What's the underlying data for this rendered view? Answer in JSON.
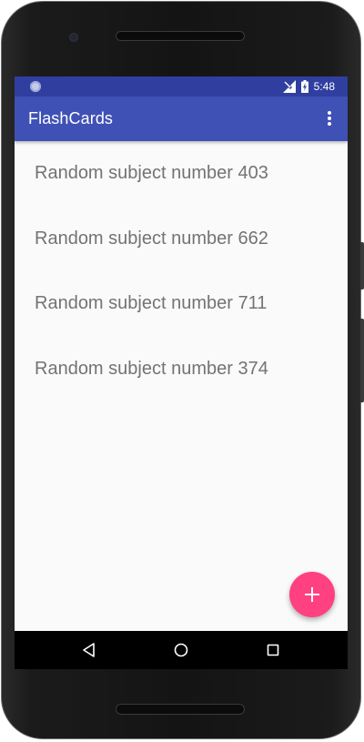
{
  "status_bar": {
    "time": "5:48",
    "icons": [
      "notification-dot-icon",
      "no-signal-icon",
      "battery-charging-icon"
    ]
  },
  "app_bar": {
    "title": "FlashCards",
    "menu_icon": "more-vert-icon"
  },
  "subjects": [
    {
      "label": "Random subject number 403"
    },
    {
      "label": "Random subject number 662"
    },
    {
      "label": "Random subject number 711"
    },
    {
      "label": "Random subject number 374"
    }
  ],
  "fab": {
    "icon": "plus-icon",
    "color": "#ff4081"
  },
  "nav_bar": {
    "buttons": [
      "back-icon",
      "home-icon",
      "recents-icon"
    ]
  },
  "colors": {
    "primary": "#3f51b5",
    "primary_dark": "#303f9f",
    "accent": "#ff4081",
    "list_text": "#737373",
    "background": "#fafafa"
  }
}
